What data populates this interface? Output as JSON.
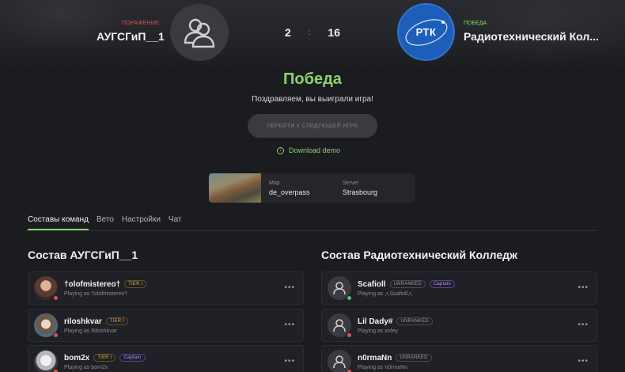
{
  "match": {
    "left_team": {
      "result": "ПОРАЖЕНИЕ:",
      "name": "АУГСГиП__1"
    },
    "right_team": {
      "result": "ПОБЕДА",
      "name": "Радиотехнический Кол...",
      "logo_text": "РТК"
    },
    "score_left": "2",
    "score_sep": ":",
    "score_right": "16"
  },
  "result": {
    "title": "Победа",
    "subtitle": "Поздравляем, вы выиграли игра!",
    "next_button": "ПЕРЕЙТИ К СЛЕДУЮЩЕЙ ИГРЕ",
    "download_demo": "Download demo"
  },
  "map_info": {
    "map_label": "Map",
    "map_value": "de_overpass",
    "server_label": "Server",
    "server_value": "Strasbourg"
  },
  "tabs": [
    "Составы команд",
    "Вето",
    "Настройки",
    "Чат"
  ],
  "rosters": {
    "left_title": "Состав АУГСГиП__1",
    "right_title": "Состав Радиотехнический Колледж",
    "left_players": [
      {
        "name": "†olofmistereo†",
        "badge": "TIER I",
        "captain": "",
        "playing_as": "Playing as †olofmistereo†",
        "status": "red"
      },
      {
        "name": "riloshkvar",
        "badge": "TIER I",
        "captain": "",
        "playing_as": "Playing as Riloshkvar",
        "status": "red"
      },
      {
        "name": "bom2x",
        "badge": "TIER I",
        "captain": "Captain",
        "playing_as": "Playing as bom2x",
        "status": "red"
      }
    ],
    "right_players": [
      {
        "name": "Scafioll",
        "badge": "UNRANKED",
        "captain": "Captain",
        "playing_as": "Playing as ,•,Scafioll,•,",
        "status": "green"
      },
      {
        "name": "Lil Dady#",
        "badge": "UNRANKED",
        "captain": "",
        "playing_as": "Playing as xnfey",
        "status": "red"
      },
      {
        "name": "n0rmaNn",
        "badge": "UNRANKED",
        "captain": "",
        "playing_as": "Playing as n0rmaNn",
        "status": "red"
      }
    ],
    "more": "•••"
  },
  "colors": {
    "accent": "#8cd36a",
    "defeat": "#e0505c",
    "status_green": "#4ec46a",
    "status_red": "#e0505c"
  }
}
